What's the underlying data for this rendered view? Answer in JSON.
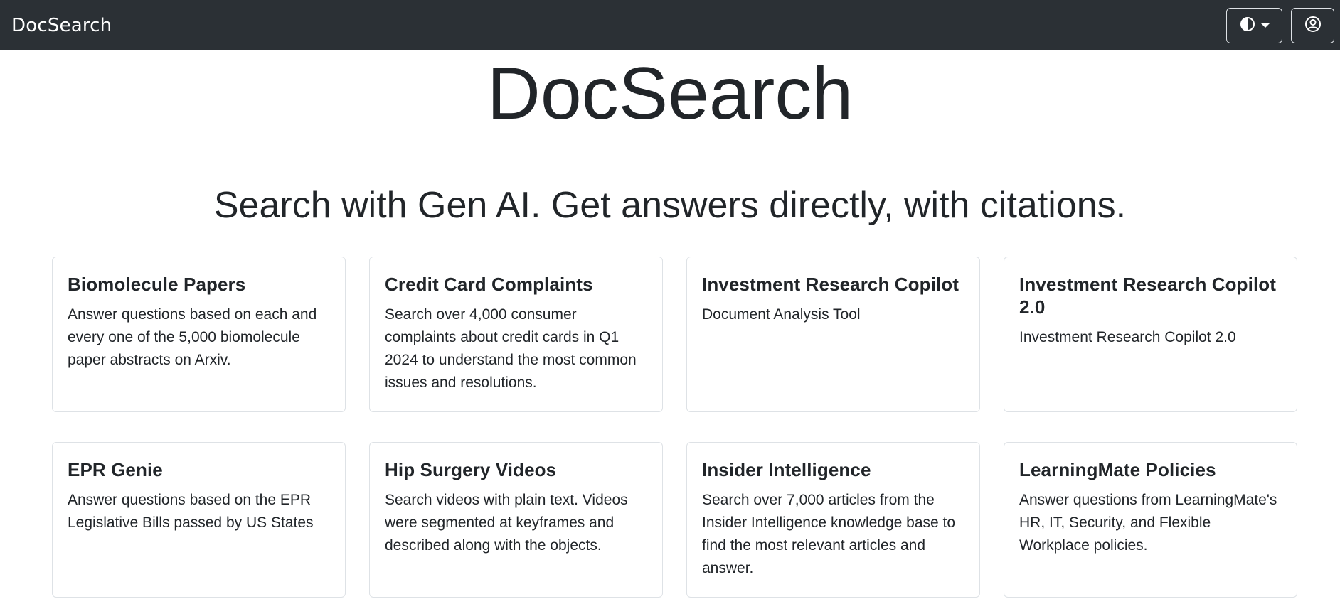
{
  "navbar": {
    "brand": "DocSearch",
    "theme_toggle_icon": "half-circle-icon",
    "user_menu_icon": "user-circle-icon"
  },
  "hero": {
    "title": "DocSearch",
    "subtitle": "Search with Gen AI. Get answers directly, with citations."
  },
  "cards": [
    {
      "title": "Biomolecule Papers",
      "description": "Answer questions based on each and every one of the 5,000 biomolecule paper abstracts on Arxiv."
    },
    {
      "title": "Credit Card Complaints",
      "description": "Search over 4,000 consumer complaints about credit cards in Q1 2024 to understand the most common issues and resolutions."
    },
    {
      "title": "Investment Research Copilot",
      "description": "Document Analysis Tool"
    },
    {
      "title": "Investment Research Copilot 2.0",
      "description": "Investment Research Copilot 2.0"
    },
    {
      "title": "EPR Genie",
      "description": "Answer questions based on the EPR Legislative Bills passed by US States"
    },
    {
      "title": "Hip Surgery Videos",
      "description": "Search videos with plain text. Videos were segmented at keyframes and described along with the objects."
    },
    {
      "title": "Insider Intelligence",
      "description": "Search over 7,000 articles from the Insider Intelligence knowledge base to find the most relevant articles and answer."
    },
    {
      "title": "LearningMate Policies",
      "description": "Answer questions from LearningMate's HR, IT, Security, and Flexible Workplace policies."
    }
  ]
}
